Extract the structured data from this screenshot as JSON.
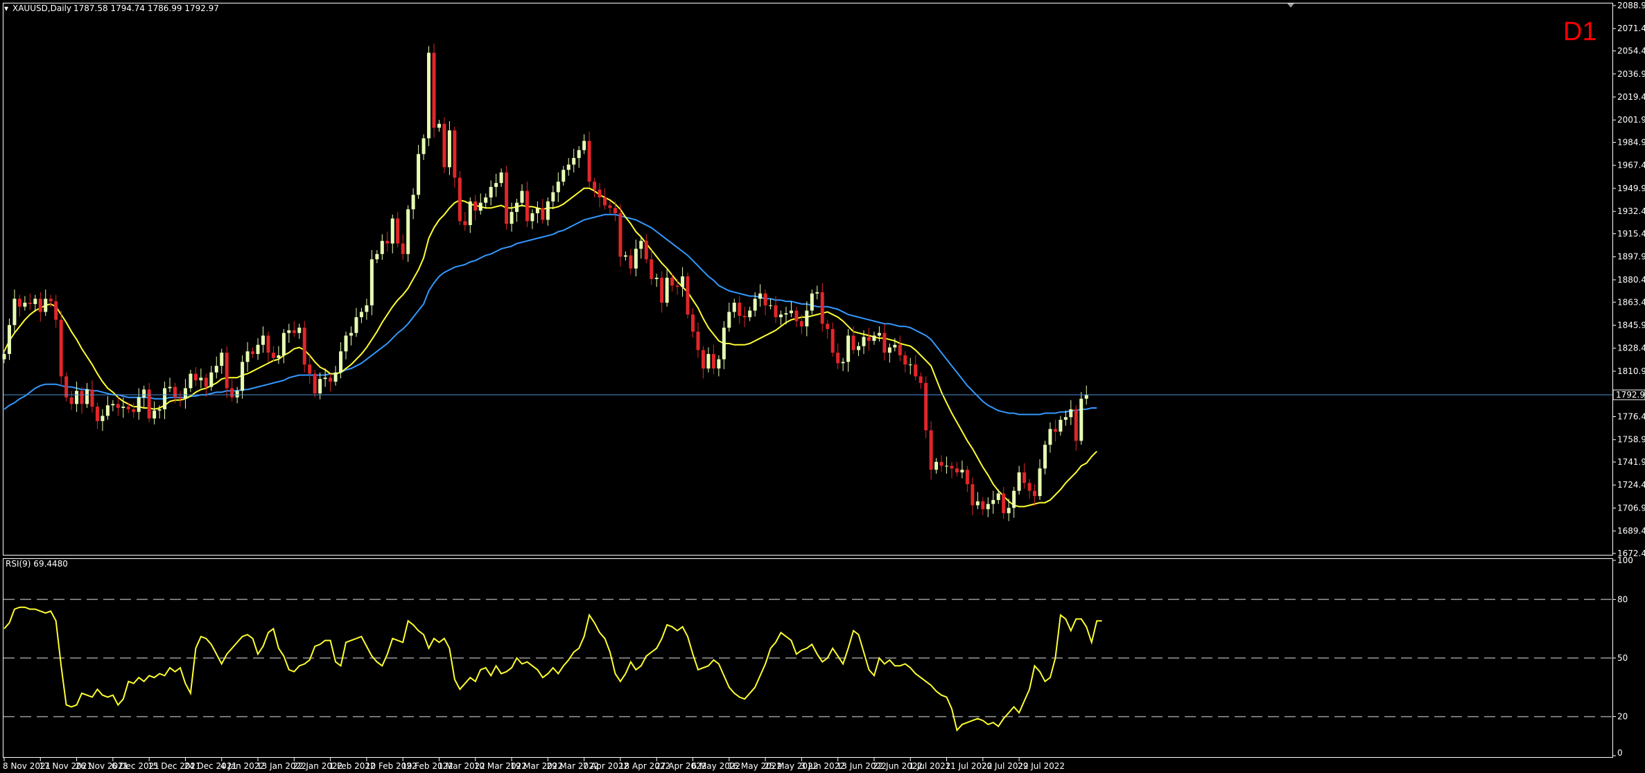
{
  "header": {
    "symbol_tf": "XAUUSD,Daily",
    "ohlc": "1787.58 1794.74 1786.99 1792.97",
    "timeframe_badge": "D1"
  },
  "colors": {
    "background": "#000000",
    "axis": "#ffffff",
    "bull_candle": "#e6ffb3",
    "bear_candle": "#e0262a",
    "ma_fast": "#ffff33",
    "ma_slow": "#3399ff",
    "price_line": "#4d8fd6",
    "rsi_line": "#ffff33",
    "rsi_levels": "#9a9a9a",
    "badge": "#ff0000"
  },
  "chart_data": [
    {
      "type": "candlestick",
      "pane": "price",
      "ylim": [
        1672.4,
        2088.9
      ],
      "price_ticks": [
        "2088.90",
        "2071.40",
        "2054.40",
        "2036.90",
        "2019.40",
        "2001.90",
        "1984.90",
        "1967.40",
        "1949.90",
        "1932.40",
        "1915.40",
        "1897.90",
        "1880.40",
        "1863.40",
        "1845.90",
        "1828.40",
        "1810.90",
        "1792.97",
        "1776.40",
        "1758.90",
        "1741.90",
        "1724.40",
        "1706.90",
        "1689.40",
        "1672.40"
      ],
      "current_price": 1792.97,
      "current_price_label": "1792.97",
      "date_labels": [
        "8 Nov 2021",
        "17 Nov 2021",
        "26 Nov 2021",
        "6 Dec 2021",
        "15 Dec 2021",
        "24 Dec 2021",
        "4 Jan 2022",
        "13 Jan 2022",
        "22 Jan 2022",
        "1 Feb 2022",
        "10 Feb 2022",
        "19 Feb 2022",
        "1 Mar 2022",
        "10 Mar 2022",
        "19 Mar 2022",
        "29 Mar 2022",
        "7 Apr 2022",
        "18 Apr 2022",
        "27 Apr 2022",
        "6 May 2022",
        "16 May 2022",
        "25 May 2022",
        "3 Jun 2022",
        "13 Jun 2022",
        "22 Jun 2022",
        "1 Jul 2022",
        "11 Jul 2022",
        "20 Jul 2022",
        "29 Jul 2022"
      ],
      "date_label_index": [
        0,
        7,
        14,
        21,
        28,
        35,
        42,
        49,
        56,
        63,
        70,
        77,
        84,
        91,
        98,
        105,
        112,
        119,
        126,
        133,
        140,
        147,
        154,
        161,
        168,
        175,
        182,
        189,
        196
      ],
      "series": [
        {
          "name": "",
          "role": "close",
          "values": [
            1824,
            1846,
            1866,
            1860,
            1863,
            1862,
            1866,
            1856,
            1866,
            1864,
            1850,
            1807,
            1791,
            1786,
            1796,
            1786,
            1797,
            1784,
            1773,
            1777,
            1785,
            1786,
            1783,
            1784,
            1782,
            1780,
            1791,
            1797,
            1775,
            1781,
            1782,
            1798,
            1799,
            1791,
            1790,
            1798,
            1809,
            1804,
            1806,
            1799,
            1810,
            1815,
            1825,
            1798,
            1791,
            1796,
            1818,
            1826,
            1824,
            1831,
            1838,
            1825,
            1821,
            1823,
            1840,
            1842,
            1840,
            1844,
            1816,
            1809,
            1794,
            1805,
            1806,
            1803,
            1810,
            1826,
            1838,
            1840,
            1852,
            1856,
            1861,
            1896,
            1900,
            1910,
            1908,
            1927,
            1908,
            1900,
            1934,
            1945,
            1976,
            1988,
            2053,
            1996,
            1999,
            1966,
            1994,
            1958,
            1925,
            1922,
            1940,
            1933,
            1939,
            1943,
            1951,
            1954,
            1962,
            1923,
            1932,
            1939,
            1948,
            1925,
            1931,
            1935,
            1926,
            1940,
            1947,
            1955,
            1964,
            1968,
            1973,
            1979,
            1986,
            1955,
            1949,
            1943,
            1937,
            1935,
            1931,
            1898,
            1899,
            1889,
            1904,
            1910,
            1896,
            1881,
            1882,
            1863,
            1882,
            1876,
            1875,
            1883,
            1854,
            1841,
            1827,
            1813,
            1824,
            1813,
            1820,
            1844,
            1856,
            1863,
            1853,
            1852,
            1857,
            1866,
            1870,
            1861,
            1861,
            1852,
            1854,
            1855,
            1857,
            1849,
            1845,
            1857,
            1870,
            1871,
            1847,
            1843,
            1825,
            1817,
            1818,
            1838,
            1827,
            1830,
            1837,
            1834,
            1838,
            1840,
            1825,
            1829,
            1831,
            1823,
            1816,
            1816,
            1807,
            1802,
            1766,
            1736,
            1742,
            1739,
            1739,
            1737,
            1734,
            1736,
            1725,
            1709,
            1712,
            1706,
            1710,
            1713,
            1718,
            1703,
            1707,
            1720,
            1734,
            1726,
            1720,
            1716,
            1737,
            1755,
            1767,
            1765,
            1774,
            1776,
            1782,
            1758,
            1790,
            1793
          ]
        },
        {
          "name": "",
          "role": "ma_fast",
          "values": [
            1826,
            1834,
            1840,
            1845,
            1850,
            1854,
            1857,
            1859,
            1861,
            1862,
            1860,
            1854,
            1848,
            1841,
            1835,
            1828,
            1822,
            1816,
            1809,
            1803,
            1798,
            1795,
            1791,
            1788,
            1786,
            1784,
            1784,
            1783,
            1783,
            1782,
            1783,
            1785,
            1788,
            1789,
            1789,
            1790,
            1792,
            1795,
            1797,
            1798,
            1800,
            1802,
            1805,
            1806,
            1806,
            1806,
            1808,
            1809,
            1811,
            1813,
            1815,
            1817,
            1819,
            1820,
            1823,
            1825,
            1828,
            1829,
            1827,
            1823,
            1818,
            1814,
            1812,
            1809,
            1809,
            1810,
            1813,
            1816,
            1820,
            1824,
            1829,
            1835,
            1841,
            1848,
            1854,
            1860,
            1865,
            1869,
            1874,
            1881,
            1888,
            1897,
            1912,
            1920,
            1926,
            1930,
            1935,
            1939,
            1941,
            1940,
            1938,
            1937,
            1936,
            1935,
            1935,
            1936,
            1937,
            1935,
            1935,
            1936,
            1937,
            1936,
            1936,
            1935,
            1934,
            1935,
            1935,
            1936,
            1938,
            1941,
            1944,
            1947,
            1950,
            1950,
            1948,
            1945,
            1943,
            1941,
            1938,
            1934,
            1928,
            1923,
            1917,
            1913,
            1908,
            1903,
            1898,
            1893,
            1889,
            1884,
            1879,
            1875,
            1871,
            1865,
            1859,
            1851,
            1844,
            1839,
            1834,
            1832,
            1832,
            1831,
            1831,
            1831,
            1832,
            1834,
            1836,
            1838,
            1840,
            1842,
            1845,
            1848,
            1850,
            1851,
            1852,
            1852,
            1853,
            1854,
            1855,
            1856,
            1854,
            1852,
            1849,
            1845,
            1841,
            1840,
            1839,
            1838,
            1837,
            1836,
            1836,
            1835,
            1834,
            1832,
            1831,
            1830,
            1827,
            1823,
            1819,
            1815,
            1805,
            1795,
            1787,
            1779,
            1772,
            1765,
            1758,
            1752,
            1745,
            1738,
            1732,
            1725,
            1720,
            1716,
            1712,
            1709,
            1708,
            1708,
            1709,
            1710,
            1711,
            1711,
            1713,
            1717,
            1721,
            1726,
            1730,
            1734,
            1739,
            1741,
            1746,
            1750
          ]
        },
        {
          "name": "",
          "role": "ma_slow",
          "values": [
            1782,
            1785,
            1787,
            1790,
            1792,
            1795,
            1798,
            1800,
            1801,
            1801,
            1801,
            1800,
            1799,
            1799,
            1798,
            1797,
            1797,
            1796,
            1796,
            1795,
            1794,
            1793,
            1793,
            1792,
            1791,
            1791,
            1791,
            1791,
            1791,
            1790,
            1790,
            1790,
            1791,
            1791,
            1791,
            1791,
            1792,
            1792,
            1793,
            1793,
            1794,
            1795,
            1795,
            1796,
            1796,
            1796,
            1797,
            1797,
            1798,
            1799,
            1800,
            1801,
            1802,
            1803,
            1804,
            1806,
            1807,
            1808,
            1808,
            1808,
            1808,
            1808,
            1808,
            1809,
            1809,
            1810,
            1812,
            1813,
            1815,
            1817,
            1820,
            1823,
            1826,
            1829,
            1832,
            1836,
            1840,
            1843,
            1847,
            1852,
            1857,
            1862,
            1872,
            1878,
            1883,
            1886,
            1888,
            1890,
            1891,
            1892,
            1894,
            1895,
            1897,
            1899,
            1900,
            1902,
            1904,
            1905,
            1906,
            1908,
            1909,
            1910,
            1911,
            1912,
            1913,
            1914,
            1915,
            1917,
            1918,
            1920,
            1922,
            1924,
            1926,
            1927,
            1928,
            1929,
            1930,
            1930,
            1930,
            1929,
            1928,
            1927,
            1926,
            1924,
            1922,
            1920,
            1917,
            1914,
            1911,
            1908,
            1905,
            1902,
            1899,
            1895,
            1891,
            1887,
            1883,
            1880,
            1876,
            1874,
            1872,
            1871,
            1870,
            1869,
            1868,
            1868,
            1867,
            1866,
            1866,
            1865,
            1865,
            1864,
            1864,
            1863,
            1862,
            1862,
            1861,
            1860,
            1860,
            1860,
            1859,
            1858,
            1856,
            1854,
            1853,
            1852,
            1851,
            1850,
            1849,
            1848,
            1847,
            1847,
            1846,
            1845,
            1845,
            1844,
            1842,
            1840,
            1838,
            1835,
            1830,
            1825,
            1820,
            1815,
            1810,
            1805,
            1800,
            1796,
            1792,
            1788,
            1785,
            1783,
            1781,
            1780,
            1779,
            1779,
            1778,
            1778,
            1778,
            1778,
            1778,
            1779,
            1779,
            1779,
            1780,
            1780,
            1781,
            1781,
            1782,
            1782,
            1783,
            1783
          ]
        }
      ]
    },
    {
      "type": "line",
      "pane": "rsi",
      "title": "RSI(9) 69.4480",
      "ylim": [
        0,
        100
      ],
      "y_ticks": [
        100,
        80,
        50,
        20,
        0
      ],
      "levels": [
        80,
        50,
        20
      ],
      "series": [
        {
          "name": "",
          "values": [
            65,
            68,
            75,
            76,
            76,
            75,
            75,
            74,
            73,
            74,
            69,
            46,
            26,
            25,
            26,
            32,
            31,
            30,
            34,
            31,
            30,
            31,
            26,
            29,
            38,
            37,
            40,
            38,
            41,
            40,
            42,
            41,
            45,
            43,
            45,
            37,
            32,
            55,
            61,
            60,
            57,
            52,
            47,
            52,
            55,
            58,
            61,
            62,
            60,
            52,
            56,
            63,
            65,
            55,
            51,
            44,
            43,
            46,
            47,
            49,
            56,
            57,
            59,
            59,
            48,
            46,
            58,
            59,
            60,
            61,
            56,
            51,
            48,
            46,
            52,
            60,
            59,
            58,
            69,
            67,
            64,
            62,
            55,
            60,
            58,
            60,
            55,
            39,
            34,
            37,
            40,
            38,
            44,
            45,
            41,
            46,
            42,
            43,
            45,
            50,
            47,
            48,
            46,
            44,
            40,
            42,
            45,
            42,
            46,
            49,
            53,
            55,
            61,
            72,
            68,
            63,
            60,
            53,
            42,
            38,
            42,
            48,
            44,
            46,
            51,
            53,
            55,
            60,
            67,
            66,
            64,
            66,
            61,
            52,
            44,
            45,
            46,
            49,
            47,
            41,
            35,
            32,
            30,
            29,
            32,
            35,
            41,
            47,
            55,
            58,
            63,
            61,
            59,
            52,
            54,
            55,
            57,
            52,
            48,
            50,
            55,
            51,
            47,
            55,
            64,
            62,
            53,
            44,
            41,
            50,
            47,
            49,
            46,
            46,
            47,
            45,
            42,
            40,
            38,
            36,
            33,
            31,
            30,
            24,
            13,
            16,
            17,
            18,
            19,
            18,
            16,
            17,
            15,
            19,
            22,
            25,
            22,
            28,
            34,
            46,
            43,
            38,
            40,
            50,
            72,
            70,
            64,
            70,
            70,
            66,
            58,
            69,
            69
          ]
        }
      ]
    }
  ]
}
